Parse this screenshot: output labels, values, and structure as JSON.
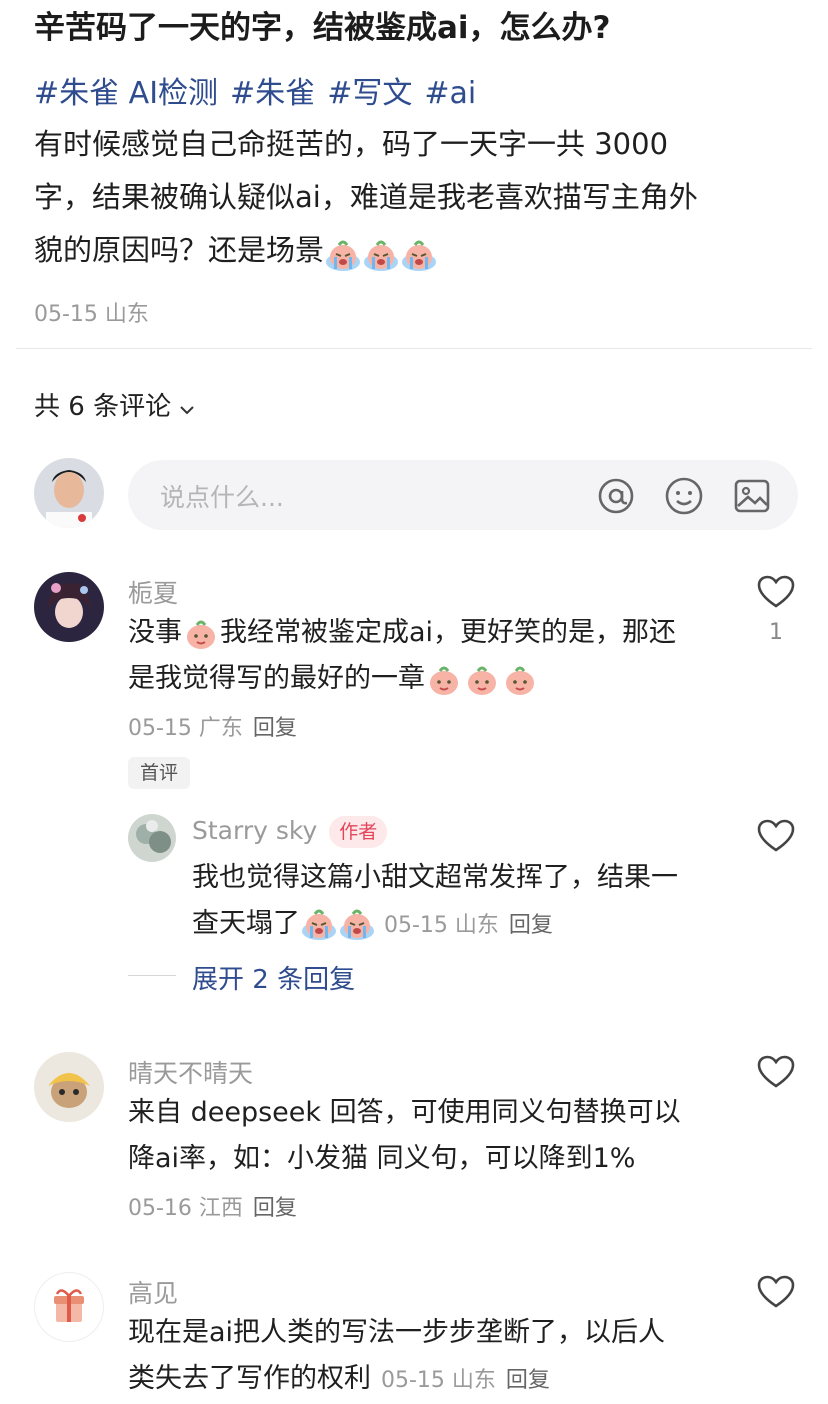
{
  "post": {
    "title": "辛苦码了一天的字，结被鉴成ai，怎么办?",
    "tags": [
      "#朱雀 AI检测",
      "#朱雀",
      "#写文",
      "#ai"
    ],
    "body_line1": "有时候感觉自己命挺苦的，码了一天字一共 3000",
    "body_line2": "字，结果被确认疑似ai，难道是我老喜欢描写主角外",
    "body_line3": "貌的原因吗？还是场景",
    "date_location": "05-15 山东"
  },
  "comments_header": {
    "label": "共 6 条评论"
  },
  "input": {
    "placeholder": "说点什么..."
  },
  "comments": [
    {
      "name": "栀夏",
      "text_line1_a": "没事",
      "text_line1_b": "我经常被鉴定成ai，更好笑的是，那还",
      "text_line2": "是我觉得写的最好的一章",
      "meta": "05-15 广东",
      "reply": "回复",
      "badge": "首评",
      "likes": "1"
    },
    {
      "name": "Starry sky",
      "author_badge": "作者",
      "text_line1": "我也觉得这篇小甜文超常发挥了，结果一",
      "text_line2": "查天塌了",
      "meta": "05-15 山东",
      "reply": "回复"
    },
    {
      "name": "晴天不晴天",
      "text_line1": "来自 deepseek 回答，可使用同义句替换可以",
      "text_line2": "降ai率，如：小发猫 同义句，可以降到1%",
      "meta": "05-16 江西",
      "reply": "回复"
    },
    {
      "name": "高见",
      "text_line1": "现在是ai把人类的写法一步步垄断了，以后人",
      "text_line2": "类失去了写作的权利",
      "meta": "05-15 山东",
      "reply": "回复"
    }
  ],
  "expand": {
    "label": "展开 2 条回复"
  },
  "colors": {
    "tag_blue": "#2f4d8e",
    "author_badge_bg": "#fde8ea",
    "author_badge_text": "#e4455a"
  }
}
